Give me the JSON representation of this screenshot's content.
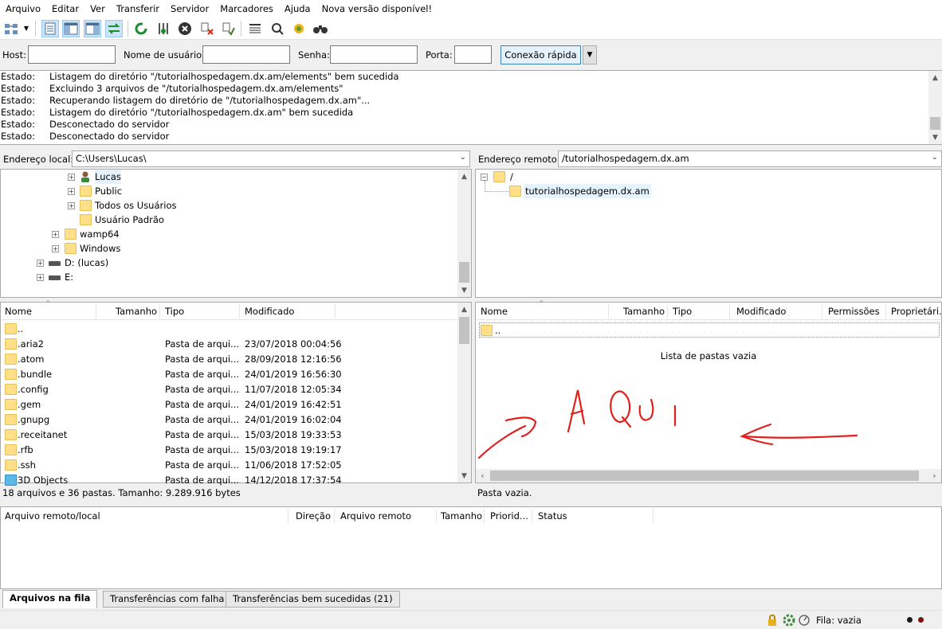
{
  "menu": [
    "Arquivo",
    "Editar",
    "Ver",
    "Transferir",
    "Servidor",
    "Marcadores",
    "Ajuda",
    "Nova versão disponível!"
  ],
  "toolbar_icons": [
    "site-manager-icon",
    "dropdown-arrow-icon",
    "toggle-log-icon",
    "toggle-local-tree-icon",
    "toggle-remote-tree-icon",
    "toggle-queue-icon",
    "refresh-icon",
    "process-queue-icon",
    "cancel-icon",
    "disconnect-icon",
    "reconnect-icon",
    "directory-filter-icon",
    "compare-icon",
    "sync-browse-icon",
    "search-icon"
  ],
  "quickconnect": {
    "host_label": "Host:",
    "user_label": "Nome de usuário:",
    "pass_label": "Senha:",
    "port_label": "Porta:",
    "host_value": "",
    "user_value": "",
    "pass_value": "",
    "port_value": "",
    "button": "Conexão rápida"
  },
  "log": [
    {
      "k": "Estado:",
      "v": "Listagem do diretório \"/tutorialhospedagem.dx.am/elements\" bem sucedida"
    },
    {
      "k": "Estado:",
      "v": "Excluindo 3 arquivos de \"/tutorialhospedagem.dx.am/elements\""
    },
    {
      "k": "Estado:",
      "v": "Recuperando listagem do diretório de \"/tutorialhospedagem.dx.am\"..."
    },
    {
      "k": "Estado:",
      "v": "Listagem do diretório \"/tutorialhospedagem.dx.am\" bem sucedida"
    },
    {
      "k": "Estado:",
      "v": "Desconectado do servidor"
    },
    {
      "k": "Estado:",
      "v": "Desconectado do servidor"
    }
  ],
  "local": {
    "address_label": "Endereço local:",
    "address": "C:\\Users\\Lucas\\",
    "tree": [
      "Lucas",
      "Public",
      "Todos os Usuários",
      "Usuário Padrão",
      "wamp64",
      "Windows",
      "D: (lucas)",
      "E:"
    ],
    "columns": {
      "name": "Nome",
      "size": "Tamanho",
      "type": "Tipo",
      "modified": "Modificado"
    },
    "files": [
      {
        "name": "..",
        "type": "",
        "modified": ""
      },
      {
        "name": ".aria2",
        "type": "Pasta de arqui...",
        "modified": "23/07/2018 00:04:56"
      },
      {
        "name": ".atom",
        "type": "Pasta de arqui...",
        "modified": "28/09/2018 12:16:56"
      },
      {
        "name": ".bundle",
        "type": "Pasta de arqui...",
        "modified": "24/01/2019 16:56:30"
      },
      {
        "name": ".config",
        "type": "Pasta de arqui...",
        "modified": "11/07/2018 12:05:34"
      },
      {
        "name": ".gem",
        "type": "Pasta de arqui...",
        "modified": "24/01/2019 16:42:51"
      },
      {
        "name": ".gnupg",
        "type": "Pasta de arqui...",
        "modified": "24/01/2019 16:02:04"
      },
      {
        "name": ".receitanet",
        "type": "Pasta de arqui...",
        "modified": "15/03/2018 19:33:53"
      },
      {
        "name": ".rfb",
        "type": "Pasta de arqui...",
        "modified": "15/03/2018 19:19:17"
      },
      {
        "name": ".ssh",
        "type": "Pasta de arqui...",
        "modified": "11/06/2018 17:52:05"
      },
      {
        "name": "3D Objects",
        "type": "Pasta de arqui...",
        "modified": "14/12/2018 17:37:54"
      }
    ],
    "status": "18 arquivos e 36 pastas. Tamanho: 9.289.916 bytes"
  },
  "remote": {
    "address_label": "Endereço remoto:",
    "address": "/tutorialhospedagem.dx.am",
    "tree": [
      "/",
      "tutorialhospedagem.dx.am"
    ],
    "columns": {
      "name": "Nome",
      "size": "Tamanho",
      "type": "Tipo",
      "modified": "Modificado",
      "perms": "Permissões",
      "owner": "Proprietári..."
    },
    "parent_row": "..",
    "empty_message": "Lista de pastas vazia",
    "annotation": "AQUI",
    "status": "Pasta vazia."
  },
  "queue": {
    "columns": {
      "file": "Arquivo remoto/local",
      "direction": "Direção",
      "remote": "Arquivo remoto",
      "size": "Tamanho",
      "priority": "Priorid...",
      "status": "Status"
    }
  },
  "tabs": [
    "Arquivos na fila",
    "Transferências com falha",
    "Transferências bem sucedidas (21)"
  ],
  "statusbar": {
    "queue": "Fila: vazia"
  },
  "colors": {
    "annotation": "#e0201b",
    "folder": "#ffe089",
    "accent": "#3c7fb1"
  }
}
